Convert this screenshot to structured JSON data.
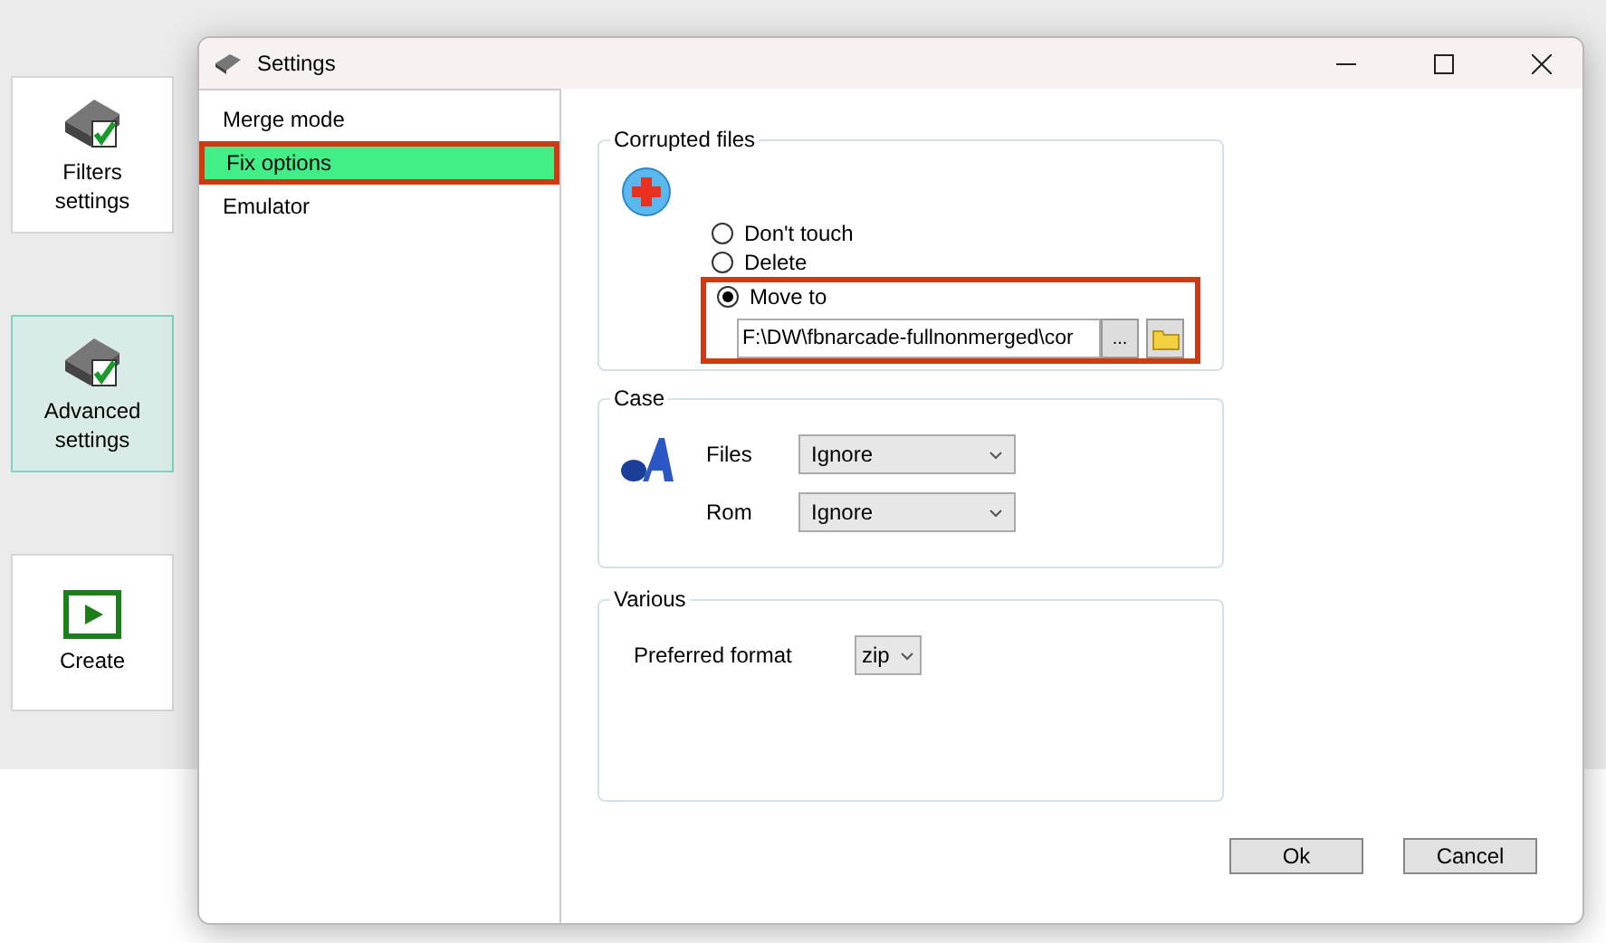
{
  "sidebar": {
    "tiles": [
      {
        "kind": "filters",
        "label": "Filters settings",
        "selected": false
      },
      {
        "kind": "filters",
        "label": "Advanced settings",
        "selected": true
      },
      {
        "kind": "play",
        "label": "Create",
        "selected": false
      }
    ]
  },
  "dialog": {
    "title": "Settings",
    "nav": [
      {
        "label": "Merge mode",
        "selected": false,
        "highlighted": false
      },
      {
        "label": "Fix options",
        "selected": true,
        "highlighted": true
      },
      {
        "label": "Emulator",
        "selected": false,
        "highlighted": false
      }
    ],
    "corrupted": {
      "title": "Corrupted files",
      "options": [
        {
          "label": "Don't touch",
          "selected": false
        },
        {
          "label": "Delete",
          "selected": false
        },
        {
          "label": "Move to",
          "selected": true
        }
      ],
      "path": "F:\\DW\\fbnarcade-fullnonmerged\\cor",
      "browse": "...",
      "highlighted": true
    },
    "case": {
      "title": "Case",
      "rows": [
        {
          "label": "Files",
          "value": "Ignore"
        },
        {
          "label": "Rom",
          "value": "Ignore"
        }
      ]
    },
    "various": {
      "title": "Various",
      "label": "Preferred format",
      "value": "zip"
    },
    "buttons": [
      "Ok",
      "Cancel"
    ]
  }
}
